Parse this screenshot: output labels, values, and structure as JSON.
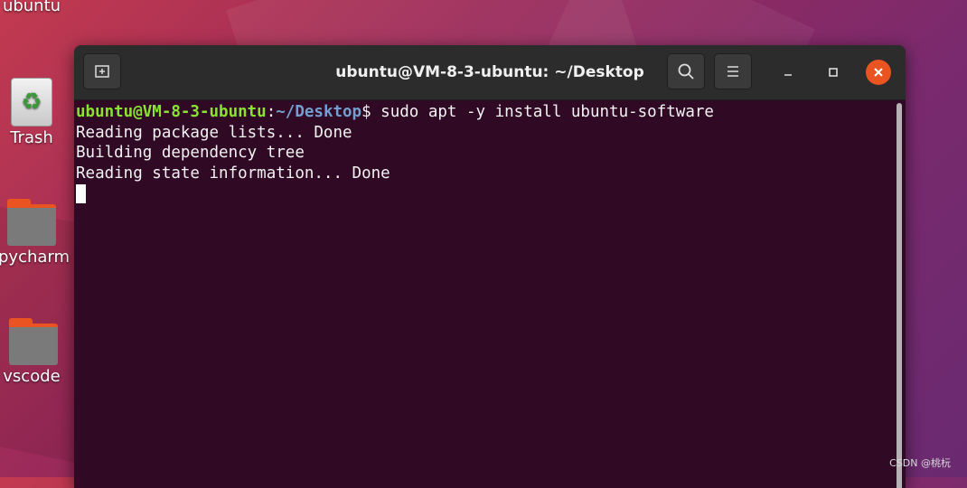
{
  "desktop": {
    "icons": [
      {
        "label": "ubuntu"
      },
      {
        "label": "Trash"
      },
      {
        "label": "pycharm"
      },
      {
        "label": "vscode"
      }
    ]
  },
  "window": {
    "title": "ubuntu@VM-8-3-ubuntu: ~/Desktop",
    "icons": {
      "new_tab": "new-tab-icon",
      "search": "search-icon",
      "menu": "hamburger-menu-icon",
      "minimize": "minimize-icon",
      "maximize": "maximize-icon",
      "close": "close-icon"
    },
    "accent": "#e95420"
  },
  "terminal": {
    "prompt_user": "ubuntu@VM-8-3-ubuntu",
    "prompt_sep": ":",
    "prompt_path": "~/Desktop",
    "prompt_symbol": "$ ",
    "command": "sudo apt -y install ubuntu-software",
    "output": [
      "Reading package lists... Done",
      "Building dependency tree",
      "Reading state information... Done"
    ],
    "background": "#300a24"
  },
  "watermark": "CSDN @桃杬"
}
